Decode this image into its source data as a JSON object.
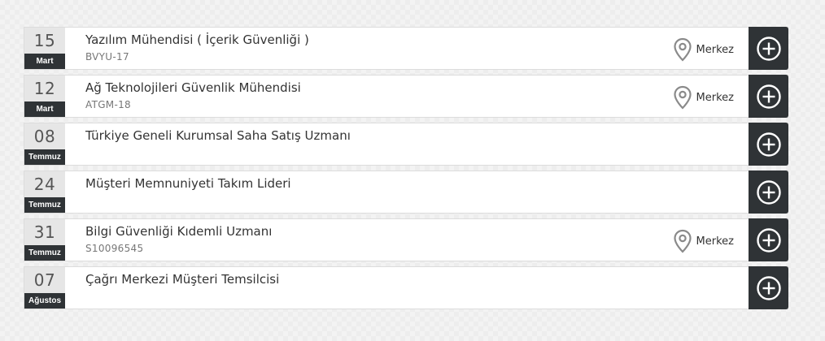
{
  "jobs": [
    {
      "day": "15",
      "month": "Mart",
      "title": "Yazılım Mühendisi ( İçerik Güvenliği )",
      "code": "BVYU-17",
      "location": "Merkez"
    },
    {
      "day": "12",
      "month": "Mart",
      "title": "Ağ Teknolojileri Güvenlik Mühendisi",
      "code": "ATGM-18",
      "location": "Merkez"
    },
    {
      "day": "08",
      "month": "Temmuz",
      "title": "Türkiye Geneli Kurumsal Saha Satış Uzmanı",
      "code": "",
      "location": ""
    },
    {
      "day": "24",
      "month": "Temmuz",
      "title": "Müşteri Memnuniyeti Takım Lideri",
      "code": "",
      "location": ""
    },
    {
      "day": "31",
      "month": "Temmuz",
      "title": "Bilgi Güvenliği Kıdemli Uzmanı",
      "code": "S10096545",
      "location": "Merkez"
    },
    {
      "day": "07",
      "month": "Ağustos",
      "title": "Çağrı Merkezi Müşteri Temsilcisi",
      "code": "",
      "location": ""
    }
  ],
  "icons": {
    "location": "map-pin-icon",
    "add": "plus-circle-icon"
  },
  "colors": {
    "dark": "#2f3336",
    "date_bg": "#e6e6e6",
    "text": "#333333",
    "muted": "#777777"
  }
}
